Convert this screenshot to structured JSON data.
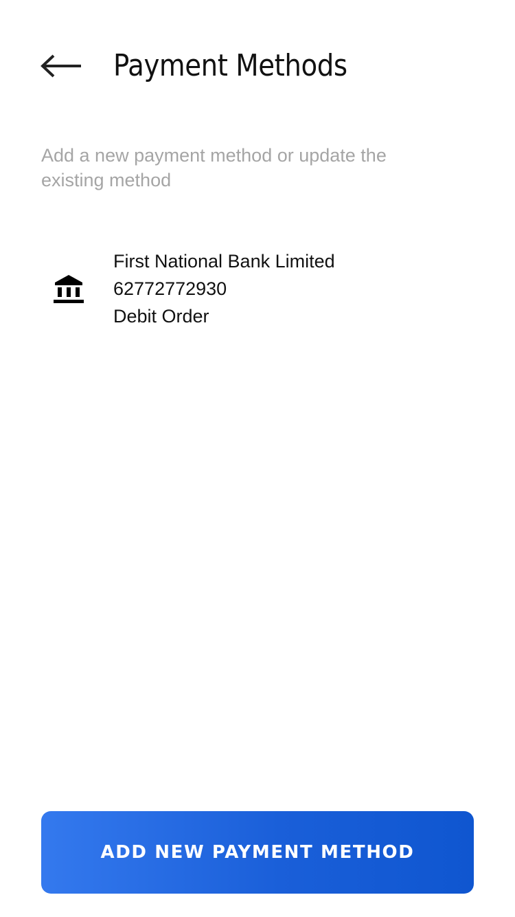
{
  "header": {
    "back_icon": "arrow-left-icon",
    "title": "Payment Methods"
  },
  "subtitle": "Add a new payment method or update the existing method",
  "payment_methods": [
    {
      "icon": "bank-icon",
      "bank_name": "First National Bank Limited",
      "account_number": "62772772930",
      "type": "Debit Order"
    }
  ],
  "footer": {
    "add_button_label": "ADD NEW PAYMENT METHOD"
  },
  "colors": {
    "button_gradient_start": "#3479ee",
    "button_gradient_end": "#0f56d0",
    "subtitle_text": "#a5a5a5",
    "primary_text": "#111111"
  }
}
